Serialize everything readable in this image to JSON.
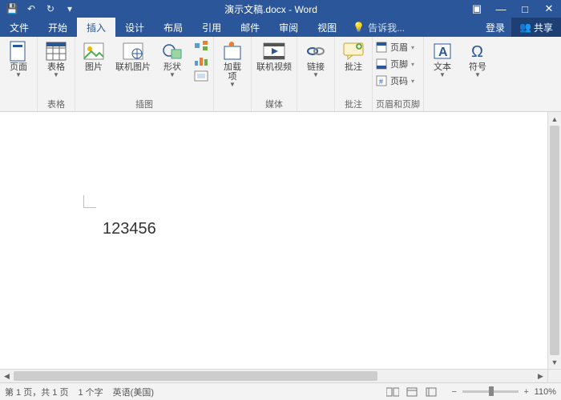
{
  "title": "演示文稿.docx - Word",
  "qat": {
    "save": "💾",
    "undo": "↶",
    "redo": "↻"
  },
  "win": {
    "opts": "▣",
    "min": "—",
    "max": "□",
    "close": "✕"
  },
  "tabs": {
    "file": "文件",
    "home": "开始",
    "insert": "插入",
    "design": "设计",
    "layout": "布局",
    "references": "引用",
    "mailings": "邮件",
    "review": "审阅",
    "view": "视图"
  },
  "tellme": {
    "icon": "💡",
    "text": "告诉我..."
  },
  "signin": "登录",
  "share": {
    "icon": "👥",
    "label": "共享"
  },
  "ribbon": {
    "pages": {
      "cover": "页面",
      "group": ""
    },
    "tables": {
      "table": "表格",
      "group": "表格"
    },
    "illus": {
      "pic": "图片",
      "online": "联机图片",
      "shapes": "形状",
      "group": "插图"
    },
    "addins": {
      "addins": "加载\n项",
      "group": ""
    },
    "media": {
      "video": "联机视频",
      "group": "媒体"
    },
    "links": {
      "link": "链接",
      "group": ""
    },
    "comments": {
      "comment": "批注",
      "group": "批注"
    },
    "headerfooter": {
      "header": "页眉",
      "footer": "页脚",
      "pagenum": "页码",
      "group": "页眉和页脚"
    },
    "text": {
      "textbox": "文本",
      "symbol": "符号",
      "group": ""
    }
  },
  "doc": {
    "content": "123456"
  },
  "status": {
    "page": "第 1 页，共 1 页",
    "words": "1 个字",
    "lang": "英语(美国)",
    "zoom": "110%"
  }
}
